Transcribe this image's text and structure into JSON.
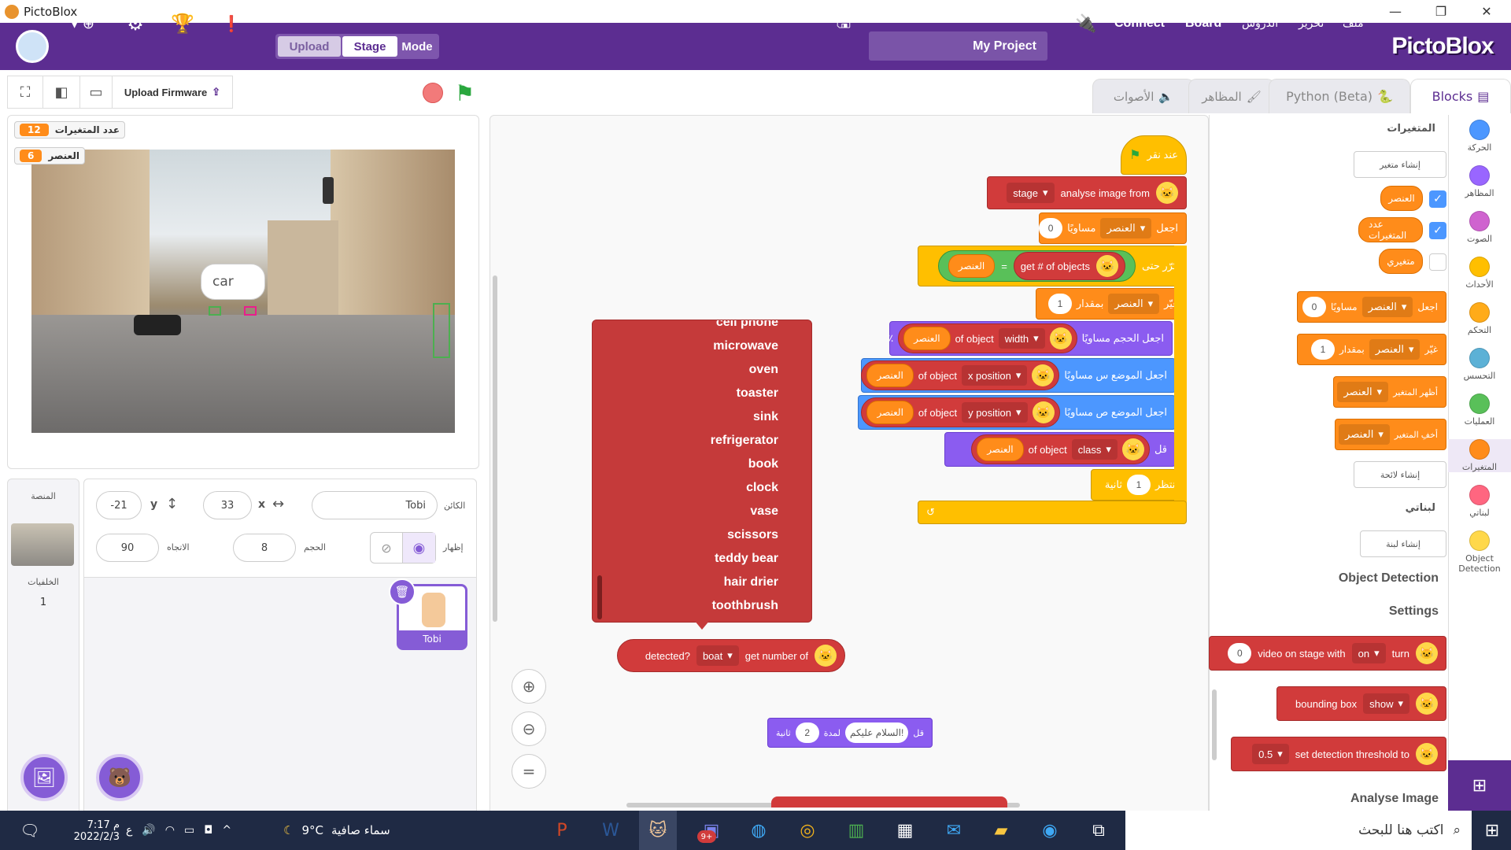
{
  "window": {
    "title": "PictoBlox",
    "min": "—",
    "restore": "❐",
    "close": "✕"
  },
  "menubar": {
    "upload": "Upload",
    "stage": "Stage",
    "mode": "Mode",
    "project_name": "My Project",
    "connect": "Connect",
    "board": "Board",
    "lessons": "الدروس",
    "edit": "تحرير",
    "file": "ملف",
    "brand": "PictoBlox"
  },
  "toolbar": {
    "upload_firmware": "Upload Firmware"
  },
  "monitors": [
    {
      "label": "عدد المتغيرات",
      "value": "12"
    },
    {
      "label": "العنصر",
      "value": "6"
    }
  ],
  "stage": {
    "speech": "car"
  },
  "sprite": {
    "sprite_label": "الكائن",
    "name": "Tobi",
    "x_label": "x",
    "x": "33",
    "y_label": "y",
    "y": "-21",
    "show_label": "إظهار",
    "size_label": "الحجم",
    "size": "8",
    "direction_label": "الاتجاه",
    "direction": "90",
    "thumb_name": "Tobi"
  },
  "stagepane": {
    "title": "المنصة",
    "backdrops_label": "الخلفيات",
    "backdrops_count": "1"
  },
  "tabs": {
    "blocks": "Blocks",
    "python": "Python (Beta)",
    "costumes": "المظاهر",
    "sounds": "الأصوات"
  },
  "script": {
    "hat": "عند نقر",
    "analyse": {
      "a": "analyse image from",
      "b": "stage"
    },
    "set0": {
      "a": "اجعل",
      "var": "العنصر",
      "b": "مساويًا",
      "val": "0"
    },
    "repeat_until": {
      "a": "كرّر حتى",
      "b": "get # of objects",
      "var": "العنصر",
      "eq": "="
    },
    "change": {
      "a": "غيّر",
      "var": "العنصر",
      "b": "بمقدار",
      "val": "1"
    },
    "size": {
      "a": "اجعل الحجم مساويًا",
      "var": "العنصر",
      "b": "of object",
      "c": "width",
      "pct": "٪"
    },
    "setx": {
      "a": "اجعل الموضع س مساويًا",
      "var": "العنصر",
      "b": "of object",
      "c": "x position"
    },
    "sety": {
      "a": "اجعل الموضع ص مساويًا",
      "var": "العنصر",
      "b": "of object",
      "c": "y position"
    },
    "say": {
      "a": "قل",
      "var": "العنصر",
      "b": "of object",
      "c": "class"
    },
    "wait": {
      "a": "انتظر",
      "val": "1",
      "b": "ثانية"
    }
  },
  "detected_block": {
    "a": "get number of",
    "b": "boat",
    "c": "detected?"
  },
  "say_block": {
    "a": "قل",
    "text": "السلام عليكم!",
    "b": "لمدة",
    "val": "2",
    "c": "ثانية"
  },
  "dropdown_items": [
    "cell phone",
    "microwave",
    "oven",
    "toaster",
    "sink",
    "refrigerator",
    "book",
    "clock",
    "vase",
    "scissors",
    "teddy bear",
    "hair drier",
    "toothbrush"
  ],
  "palette": {
    "vars_title": "المتغيرات",
    "make_var": "إنشاء متغير",
    "var1": "العنصر",
    "var2": "عدد المتغيرات",
    "var3": "متغيري",
    "set": {
      "a": "اجعل",
      "var": "العنصر",
      "b": "مساويًا",
      "val": "0"
    },
    "change": {
      "a": "غيّر",
      "var": "العنصر",
      "b": "بمقدار",
      "val": "1"
    },
    "show_var": {
      "a": "أظهر المتغير",
      "var": "العنصر"
    },
    "hide_var": {
      "a": "أخفِ المتغير",
      "var": "العنصر"
    },
    "make_list": "إنشاء لائحة",
    "myblocks_title": "لبناتي",
    "make_block": "إنشاء لبنة",
    "od_title": "Object Detection",
    "settings_title": "Settings",
    "video": {
      "a": "turn",
      "b": "on",
      "c": "video on stage with",
      "val": "0"
    },
    "bbox": {
      "a": "show",
      "b": "bounding box"
    },
    "threshold": {
      "a": "set detection threshold to",
      "b": "0.5"
    },
    "analyse_title": "Analyse Image"
  },
  "categories": [
    {
      "label": "الحركة",
      "color": "#4c97ff"
    },
    {
      "label": "المظاهر",
      "color": "#9966ff"
    },
    {
      "label": "الصوت",
      "color": "#cf63cf"
    },
    {
      "label": "الأحداث",
      "color": "#ffbf00"
    },
    {
      "label": "التحكم",
      "color": "#ffab19"
    },
    {
      "label": "التحسس",
      "color": "#5cb1d6"
    },
    {
      "label": "العمليات",
      "color": "#59c059"
    },
    {
      "label": "المتغيرات",
      "color": "#ff8c1a"
    },
    {
      "label": "لبناتي",
      "color": "#ff6680"
    },
    {
      "label": "Object Detection",
      "color": "#ffd84a"
    }
  ],
  "taskbar": {
    "search": "اكتب هنا للبحث",
    "weather": "سماء صافية",
    "temp": "9°C",
    "time": "7:17 م",
    "date": "2022/2/3",
    "lang": "ع",
    "badge": "9+"
  }
}
